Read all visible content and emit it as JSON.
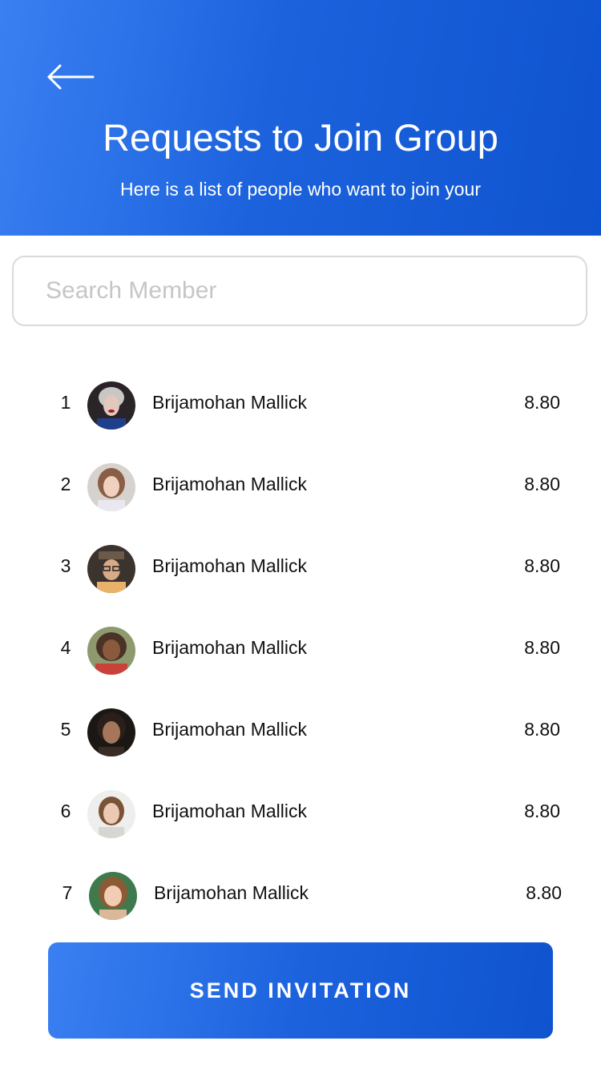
{
  "header": {
    "title": "Requests to Join Group",
    "subtitle": "Here is a list of people who want to join your",
    "back_icon": "arrow-left-icon",
    "gradient_start": "#3a80f2",
    "gradient_end": "#0f53cf"
  },
  "search": {
    "placeholder": "Search Member",
    "value": ""
  },
  "members": [
    {
      "rank": "1",
      "name": "Brijamohan Mallick",
      "score": "8.80",
      "avatar": "avatar-photo-icon"
    },
    {
      "rank": "2",
      "name": "Brijamohan Mallick",
      "score": "8.80",
      "avatar": "avatar-photo-icon"
    },
    {
      "rank": "3",
      "name": "Brijamohan Mallick",
      "score": "8.80",
      "avatar": "avatar-photo-icon"
    },
    {
      "rank": "4",
      "name": "Brijamohan Mallick",
      "score": "8.80",
      "avatar": "avatar-photo-icon"
    },
    {
      "rank": "5",
      "name": "Brijamohan Mallick",
      "score": "8.80",
      "avatar": "avatar-photo-icon"
    },
    {
      "rank": "6",
      "name": "Brijamohan Mallick",
      "score": "8.80",
      "avatar": "avatar-photo-icon"
    },
    {
      "rank": "7",
      "name": "Brijamohan Mallick",
      "score": "8.80",
      "avatar": "avatar-photo-icon"
    }
  ],
  "footer": {
    "send_label": "SEND INVITATION"
  }
}
